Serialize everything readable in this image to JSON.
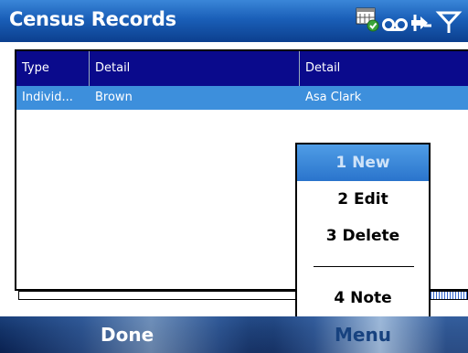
{
  "window": {
    "title": "Census Records"
  },
  "status_icons": [
    "calendar-sync-icon",
    "voicemail-icon",
    "connection-arrows-icon",
    "signal-antenna-icon"
  ],
  "list": {
    "columns": [
      "Type",
      "Detail",
      "Detail"
    ],
    "rows": [
      {
        "type": "Individ...",
        "detail1": "Brown",
        "detail2": "Asa Clark",
        "selected": true
      }
    ]
  },
  "menu": {
    "items": [
      {
        "label": "1 New",
        "selected": true
      },
      {
        "label": "2 Edit",
        "selected": false
      },
      {
        "label": "3 Delete",
        "selected": false
      },
      {
        "label": "4 Note",
        "selected": false
      }
    ]
  },
  "softkeys": {
    "left": "Done",
    "right": "Menu"
  },
  "colors": {
    "title_bar": "#1a5fb8",
    "list_header": "#0a0a8c",
    "selection": "#3d8fdc",
    "softkey_bar": "#123166"
  }
}
